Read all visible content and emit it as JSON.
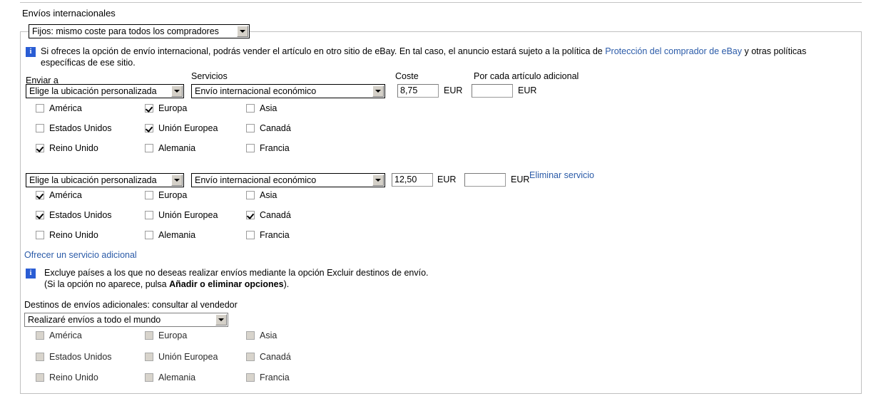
{
  "page": {
    "section_title": "Envíos internacionales"
  },
  "shipping_type": {
    "selected": "Fijos: mismo coste para todos los compradores"
  },
  "info_primary": {
    "icon": "info-icon",
    "text_before_link": "Si ofreces la opción de envío internacional, podrás vender el artículo en otro sitio de eBay. En tal caso, el anuncio estará sujeto a la política de ",
    "link": "Protección del comprador de eBay",
    "text_after_link": " y otras políticas",
    "line2": "específicas de ese sitio."
  },
  "column_headers": {
    "ship_to": "Enviar a",
    "services": "Servicios",
    "cost": "Coste",
    "each_additional": "Por cada artículo adicional"
  },
  "currency": "EUR",
  "services": [
    {
      "location_selected": "Elige la ubicación personalizada",
      "service_selected": "Envío internacional económico",
      "cost": "8,75",
      "additional_cost": "",
      "remove_label": "",
      "destinations": [
        {
          "label": "América",
          "checked": false
        },
        {
          "label": "Europa",
          "checked": true
        },
        {
          "label": "Asia",
          "checked": false
        },
        {
          "label": "Estados Unidos",
          "checked": false
        },
        {
          "label": "Unión Europea",
          "checked": true
        },
        {
          "label": "Canadá",
          "checked": false
        },
        {
          "label": "Reino Unido",
          "checked": true
        },
        {
          "label": "Alemania",
          "checked": false
        },
        {
          "label": "Francia",
          "checked": false
        }
      ]
    },
    {
      "location_selected": "Elige la ubicación personalizada",
      "service_selected": "Envío internacional económico",
      "cost": "12,50",
      "additional_cost": "",
      "remove_label": "Eliminar servicio",
      "destinations": [
        {
          "label": "América",
          "checked": true
        },
        {
          "label": "Europa",
          "checked": false
        },
        {
          "label": "Asia",
          "checked": false
        },
        {
          "label": "Estados Unidos",
          "checked": true
        },
        {
          "label": "Unión Europea",
          "checked": false
        },
        {
          "label": "Canadá",
          "checked": true
        },
        {
          "label": "Reino Unido",
          "checked": false
        },
        {
          "label": "Alemania",
          "checked": false
        },
        {
          "label": "Francia",
          "checked": false
        }
      ]
    }
  ],
  "add_service": {
    "label": "Ofrecer un servicio adicional"
  },
  "info_secondary": {
    "icon": "info-icon",
    "line1": "Excluye países a los que no deseas realizar envíos mediante la opción Excluir destinos de envío.",
    "line2_before": "(Si la opción no aparece, pulsa ",
    "line2_bold": "Añadir o eliminar opciones",
    "line2_after": ")."
  },
  "additional_destinations": {
    "label": "Destinos de envíos adicionales: consultar al vendedor",
    "selected": "Realizaré envíos a todo el mundo",
    "destinations": [
      {
        "label": "América",
        "checked": false
      },
      {
        "label": "Europa",
        "checked": false
      },
      {
        "label": "Asia",
        "checked": false
      },
      {
        "label": "Estados Unidos",
        "checked": false
      },
      {
        "label": "Unión Europea",
        "checked": false
      },
      {
        "label": "Canadá",
        "checked": false
      },
      {
        "label": "Reino Unido",
        "checked": false
      },
      {
        "label": "Alemania",
        "checked": false
      },
      {
        "label": "Francia",
        "checked": false
      }
    ]
  },
  "colors": {
    "link": "#2b5ba8",
    "info_icon_bg": "#2a5dd4",
    "frame_border": "#c0c0c0"
  }
}
